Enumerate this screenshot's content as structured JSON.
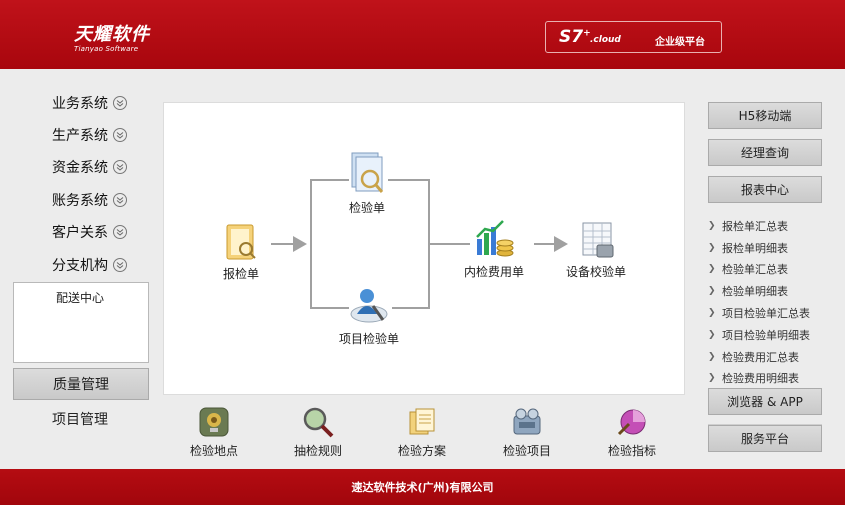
{
  "header": {
    "logo_cn": "天耀软件",
    "logo_en": "Tianyao Software",
    "brand_s7": "S7",
    "brand_sup": "+",
    "brand_cloud": ".cloud",
    "brand_tag": "企业级平台"
  },
  "sidebar": {
    "items": [
      {
        "label": "业务系统"
      },
      {
        "label": "生产系统"
      },
      {
        "label": "资金系统"
      },
      {
        "label": "账务系统"
      },
      {
        "label": "客户关系"
      },
      {
        "label": "分支机构"
      }
    ],
    "sub_items": [
      "配送中心"
    ],
    "active_button": "质量管理",
    "link": "项目管理"
  },
  "flow": {
    "baojiandan": "报检单",
    "jianyandan": "检验单",
    "xiangmu_jianyandan": "项目检验单",
    "neijian_feiyong": "内检费用单",
    "shebei_jiaoyan": "设备校验单"
  },
  "bottom": {
    "items": [
      "检验地点",
      "抽检规则",
      "检验方案",
      "检验项目",
      "检验指标"
    ]
  },
  "right": {
    "h5": "H5移动端",
    "manager": "经理查询",
    "report_center": "报表中心",
    "reports": [
      "报检单汇总表",
      "报检单明细表",
      "检验单汇总表",
      "检验单明细表",
      "项目检验单汇总表",
      "项目检验单明细表",
      "检验费用汇总表",
      "检验费用明细表"
    ],
    "browser_app": "浏览器 & APP",
    "service": "服务平台"
  },
  "footer": {
    "text": "速达软件技术(广州)有限公司"
  },
  "colors": {
    "brand_red": "#b5080f",
    "panel_bg": "#ececec"
  }
}
